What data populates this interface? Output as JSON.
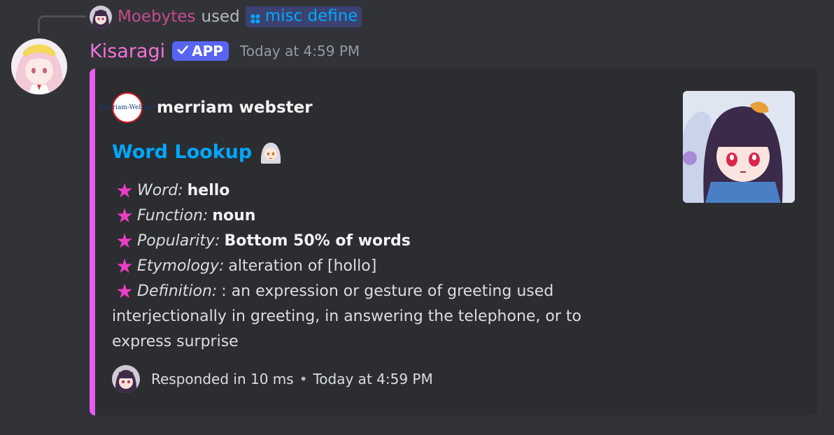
{
  "reply": {
    "user": "Moebytes",
    "used_text": "used",
    "command": "misc define"
  },
  "message": {
    "author": "Kisaragi",
    "badge": "APP",
    "timestamp": "Today at 4:59 PM"
  },
  "embed": {
    "accent_color": "#e85bf0",
    "author_name": "merriam webster",
    "logo_text": "Merriam-Webster",
    "title": "Word Lookup",
    "fields": [
      {
        "label": "Word:",
        "value": "hello",
        "bold": true
      },
      {
        "label": "Function:",
        "value": "noun",
        "bold": true
      },
      {
        "label": "Popularity:",
        "value": "Bottom 50% of words",
        "bold": true
      },
      {
        "label": "Etymology:",
        "value": "alteration of [hollo]",
        "bold": false
      }
    ],
    "definition": {
      "label": "Definition:",
      "value": ": an expression or gesture of greeting used interjectionally in greeting, in answering the telephone, or to express surprise"
    },
    "footer": {
      "text": "Responded in 10 ms",
      "separator": "•",
      "timestamp": "Today at 4:59 PM"
    }
  },
  "icons": {
    "star": "★",
    "command": "command-grid-icon",
    "badge_check": "checkmark-icon"
  }
}
